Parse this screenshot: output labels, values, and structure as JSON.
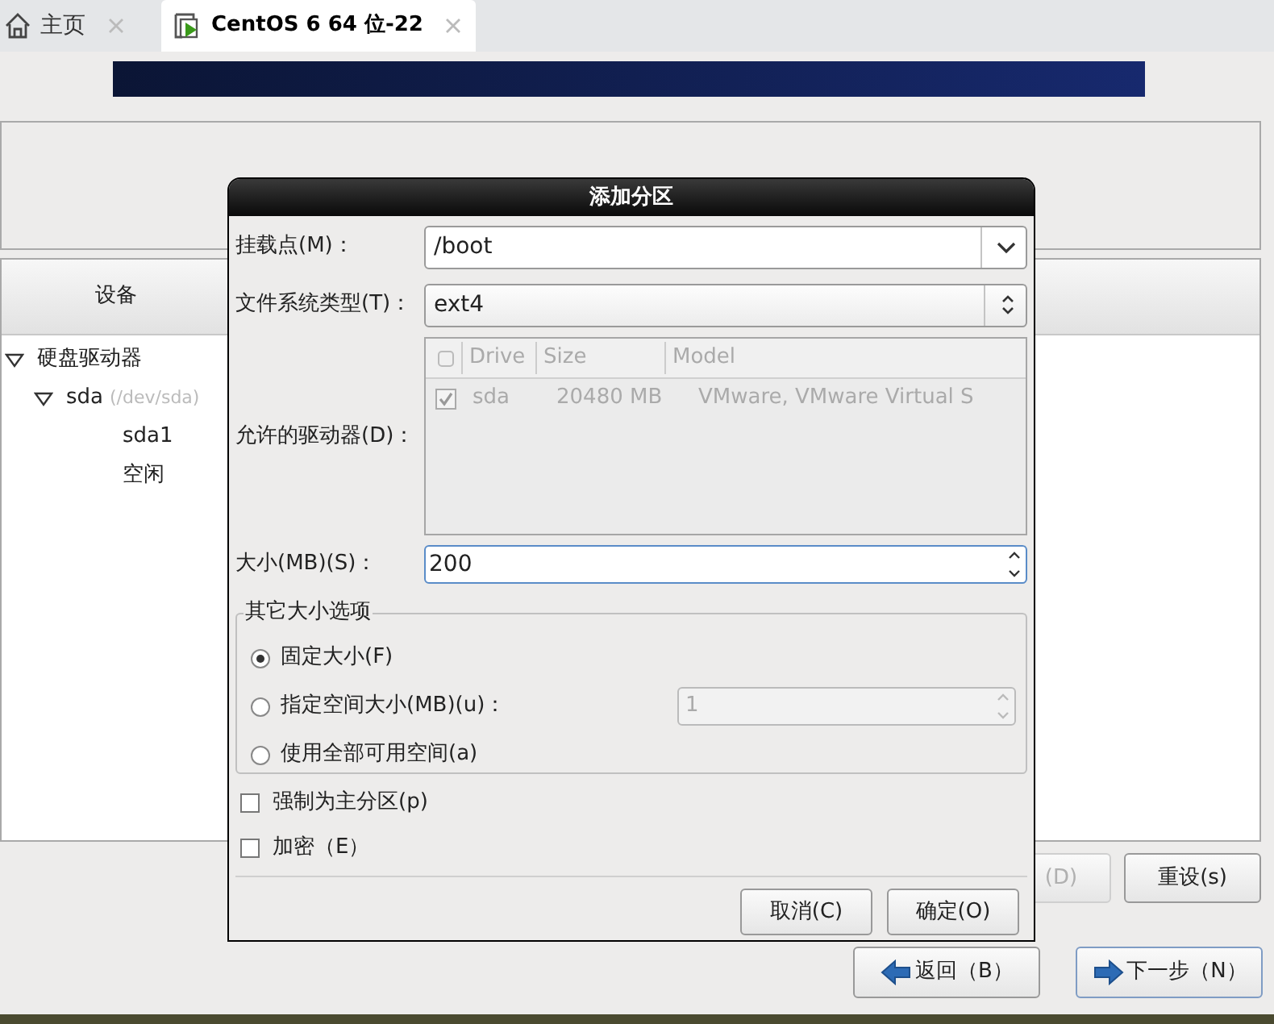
{
  "tabs": [
    {
      "label": "主页",
      "selected": false,
      "kind": "home"
    },
    {
      "label": "CentOS 6 64 位-22",
      "selected": true,
      "kind": "vm"
    }
  ],
  "page": {
    "device_column": "设备",
    "tree": [
      {
        "label": "硬盘驱动器",
        "expanded": true,
        "children": [
          {
            "label": "sda",
            "detail": "(/dev/sda)",
            "expanded": true,
            "children": [
              {
                "label": "sda1"
              },
              {
                "label": "空闲"
              }
            ]
          }
        ]
      }
    ],
    "buttons": [
      {
        "label": "(D)",
        "disabled": true
      },
      {
        "label": "重设(s)",
        "disabled": false
      }
    ],
    "nav_buttons": [
      {
        "label": "返回（B）",
        "kind": "back"
      },
      {
        "label": "下一步（N）",
        "kind": "next"
      }
    ]
  },
  "dialog": {
    "title": "添加分区",
    "fields": [
      {
        "label": "挂载点(M)：",
        "kind": "combo-entry",
        "value": "/boot"
      },
      {
        "label": "文件系统类型(T)：",
        "kind": "combo",
        "value": "ext4"
      }
    ],
    "drives": {
      "label": "允许的驱动器(D)：",
      "disabled": true,
      "columns": [
        "Drive",
        "Size",
        "Model"
      ],
      "rows": [
        {
          "checked": true,
          "drive": "sda",
          "size": "20480 MB",
          "model": "VMware, VMware Virtual S"
        }
      ]
    },
    "size": {
      "label": "大小(MB)(S)：",
      "value": "200",
      "focused": true
    },
    "size_options": {
      "title": "其它大小选项",
      "options": [
        {
          "label": "固定大小(F)",
          "selected": true
        },
        {
          "label": "指定空间大小(MB)(u)：",
          "selected": false,
          "value": "1"
        },
        {
          "label": "使用全部可用空间(a)",
          "selected": false
        }
      ]
    },
    "checkboxes": [
      {
        "label": "强制为主分区(p)",
        "checked": false
      },
      {
        "label": "加密（E）",
        "checked": false
      }
    ],
    "buttons": [
      "取消(C)",
      "确定(O)"
    ]
  }
}
